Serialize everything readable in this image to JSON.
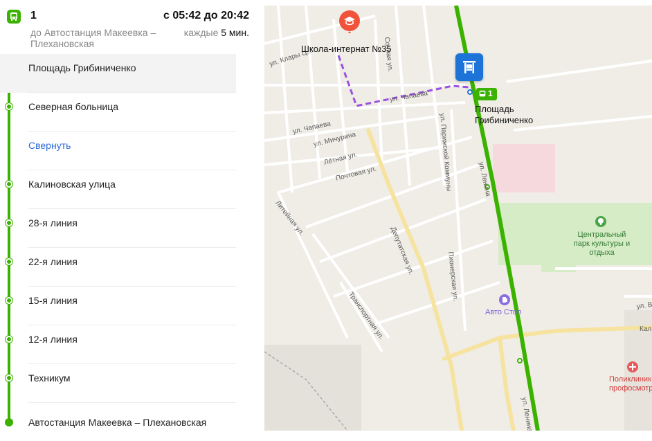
{
  "route": {
    "number": "1",
    "direction": "до Автостанция Макеевка – Плехановская",
    "schedule": "с 05:42 до 20:42",
    "interval_prefix": "каждые",
    "interval_value": "5 мин."
  },
  "stops": [
    {
      "label": "Площадь Грибиниченко",
      "current": true
    },
    {
      "label": "Северная больница"
    },
    {
      "label": "Свернуть",
      "collapse": true
    },
    {
      "label": "Калиновская улица"
    },
    {
      "label": "28-я линия"
    },
    {
      "label": "22-я линия"
    },
    {
      "label": "15-я линия"
    },
    {
      "label": "12-я линия"
    },
    {
      "label": "Техникум"
    },
    {
      "label": "Автостанция Макеевка – Плехановская",
      "last": true
    }
  ],
  "map": {
    "school": "Школа-интернат №35",
    "stop_name": "Площадь Грибиниченко",
    "route_chip": "1",
    "park": "Центральный парк культуры и отдыха",
    "gas_station": "Авто Стоп",
    "clinic": "Поликлиник профосмотр",
    "streets": {
      "klary": "ул. Клары Ц...",
      "chapaeva1": "ул. Чапаева",
      "chapaeva2": "ул. Чапаева",
      "michurina": "ул. Мичурина",
      "letnyaya": "Лётная ул.",
      "pochtovaya": "Почтовая ул.",
      "deputatskaya": "Депутатская ул.",
      "parizhskoy": "ул. Парижской Коммуны",
      "lenina1": "ул. Ленина",
      "lenina2": "ул. Ленина",
      "liteynaya": "Литейная ул.",
      "transportnaya": "Транспортная ул.",
      "pionerskaya": "Пионерская ул.",
      "sochnaya": "Сочная ул.",
      "kal": "Кал",
      "ulv": "ул. В"
    },
    "colors": {
      "route": "#3bb200",
      "stop_marker": "#1e73d8",
      "walk_path": "#9b51e0",
      "school_pin": "#f0533c"
    }
  }
}
